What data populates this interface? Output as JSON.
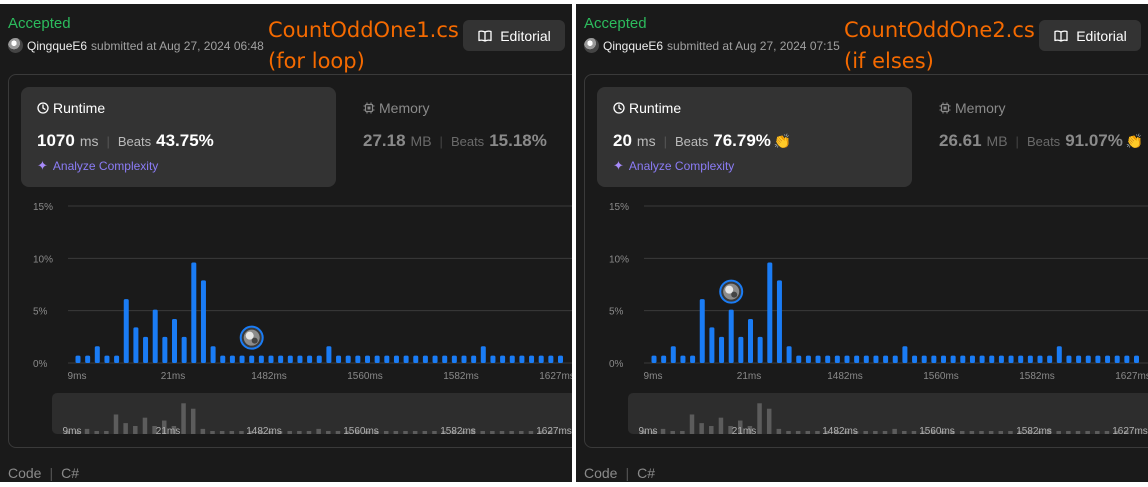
{
  "panels": [
    {
      "status": "Accepted",
      "username": "QingqueE6",
      "submitted_text": "submitted at Aug 27, 2024 06:48",
      "note_line1": "CountOddOne1.cs",
      "note_line2": "(for loop)",
      "editorial_label": "Editorial",
      "runtime": {
        "title": "Runtime",
        "value": "1070",
        "unit": "ms",
        "beats_label": "Beats",
        "beats": "43.75%",
        "celebrate": false
      },
      "memory": {
        "title": "Memory",
        "value": "27.18",
        "unit": "MB",
        "beats_label": "Beats",
        "beats": "15.18%",
        "celebrate": false
      },
      "analyze_label": "Analyze Complexity",
      "footer": {
        "code_label": "Code",
        "language": "C#"
      },
      "chart_data": {
        "type": "bar",
        "ylabel_ticks": [
          "15%",
          "10%",
          "5%",
          "0%"
        ],
        "ylim": [
          0,
          15
        ],
        "x_tick_labels": [
          "9ms",
          "21ms",
          "1482ms",
          "1560ms",
          "1582ms",
          "1627ms"
        ],
        "values": [
          0.7,
          0.7,
          1.6,
          0.7,
          0.7,
          6.1,
          3.4,
          2.5,
          5.1,
          2.5,
          4.2,
          2.5,
          9.6,
          7.9,
          1.6,
          0.7,
          0.7,
          0.7,
          0.7,
          0.7,
          0.7,
          0.7,
          0.7,
          0.7,
          0.7,
          0.7,
          1.6,
          0.7,
          0.7,
          0.7,
          0.7,
          0.7,
          0.7,
          0.7,
          0.7,
          0.7,
          0.7,
          0.7,
          0.7,
          0.7,
          0.7,
          0.7,
          1.6,
          0.7,
          0.7,
          0.7,
          0.7,
          0.7,
          0.7,
          0.7,
          0.7
        ],
        "marker_bar": 18,
        "bar_color": "#1a7cf5",
        "overview_color": "#5c5c5c"
      }
    },
    {
      "status": "Accepted",
      "username": "QingqueE6",
      "submitted_text": "submitted at Aug 27, 2024 07:15",
      "note_line1": "CountOddOne2.cs",
      "note_line2": "(if elses)",
      "editorial_label": "Editorial",
      "runtime": {
        "title": "Runtime",
        "value": "20",
        "unit": "ms",
        "beats_label": "Beats",
        "beats": "76.79%",
        "celebrate": true
      },
      "memory": {
        "title": "Memory",
        "value": "26.61",
        "unit": "MB",
        "beats_label": "Beats",
        "beats": "91.07%",
        "celebrate": true
      },
      "analyze_label": "Analyze Complexity",
      "footer": {
        "code_label": "Code",
        "language": "C#"
      },
      "chart_data": {
        "type": "bar",
        "ylabel_ticks": [
          "15%",
          "10%",
          "5%",
          "0%"
        ],
        "ylim": [
          0,
          15
        ],
        "x_tick_labels": [
          "9ms",
          "21ms",
          "1482ms",
          "1560ms",
          "1582ms",
          "1627ms"
        ],
        "values": [
          0.7,
          0.7,
          1.6,
          0.7,
          0.7,
          6.1,
          3.4,
          2.5,
          5.1,
          2.5,
          4.2,
          2.5,
          9.6,
          7.9,
          1.6,
          0.7,
          0.7,
          0.7,
          0.7,
          0.7,
          0.7,
          0.7,
          0.7,
          0.7,
          0.7,
          0.7,
          1.6,
          0.7,
          0.7,
          0.7,
          0.7,
          0.7,
          0.7,
          0.7,
          0.7,
          0.7,
          0.7,
          0.7,
          0.7,
          0.7,
          0.7,
          0.7,
          1.6,
          0.7,
          0.7,
          0.7,
          0.7,
          0.7,
          0.7,
          0.7,
          0.7
        ],
        "marker_bar": 8,
        "bar_color": "#1a7cf5",
        "overview_color": "#5c5c5c"
      }
    }
  ]
}
